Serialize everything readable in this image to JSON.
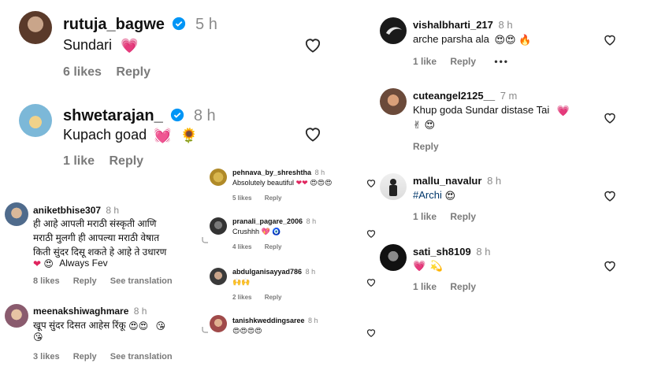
{
  "colors": {
    "heart_outline": "#262626",
    "verified": "#0095f6",
    "muted": "#8a8a8a",
    "hashtag": "#00376b",
    "emoji_pink": "#e8458b"
  },
  "comments": {
    "c1": {
      "user": "rutuja_bagwe",
      "time": "5 h",
      "text": "Sundari",
      "likes": "6 likes",
      "reply": "Reply",
      "verified": true
    },
    "c2": {
      "user": "shwetarajan_",
      "time": "8 h",
      "text": "Kupach goad",
      "likes": "1 like",
      "reply": "Reply",
      "verified": true
    },
    "c3": {
      "user": "aniketbhise307",
      "time": "8 h",
      "line1": "ही आहे आपली मराठी संस्कृती आणि",
      "line2": "मराठी मुलगी ही आपल्या मराठी वेषात",
      "line3": "किती सुंदर दिसू शकते हे आहे ते उधारण",
      "line4": "Always Fev",
      "likes": "8 likes",
      "reply": "Reply",
      "see_translation": "See translation"
    },
    "c4": {
      "user": "meenakshiwaghmare",
      "time": "8 h",
      "text": "खूप सुंदर दिसत आहेस रिंकू",
      "likes": "3 likes",
      "reply": "Reply",
      "see_translation": "See translation"
    },
    "c5": {
      "user": "pehnava_by_shreshtha",
      "time": "8 h",
      "text": "Absolutely beautiful",
      "likes": "5 likes",
      "reply": "Reply"
    },
    "c6": {
      "user": "pranali_pagare_2006",
      "time": "8 h",
      "text": "Crushhh",
      "likes": "4 likes",
      "reply": "Reply"
    },
    "c7": {
      "user": "abdulganisayyad786",
      "time": "8 h",
      "likes": "2 likes",
      "reply": "Reply"
    },
    "c8": {
      "user": "tanishkweddingsaree",
      "time": "8 h"
    },
    "c9": {
      "user": "vishalbharti_217",
      "time": "8 h",
      "text": "arche parsha ala",
      "likes": "1 like",
      "reply": "Reply",
      "more": "•••"
    },
    "c10": {
      "user": "cuteangel2125__",
      "time": "7 m",
      "text": "Khup goda Sundar distase Tai",
      "reply": "Reply"
    },
    "c11": {
      "user": "mallu_navalur",
      "time": "8 h",
      "text": "#Archi",
      "likes": "1 like",
      "reply": "Reply"
    },
    "c12": {
      "user": "sati_sh8109",
      "time": "8 h",
      "likes": "1 like",
      "reply": "Reply"
    }
  }
}
